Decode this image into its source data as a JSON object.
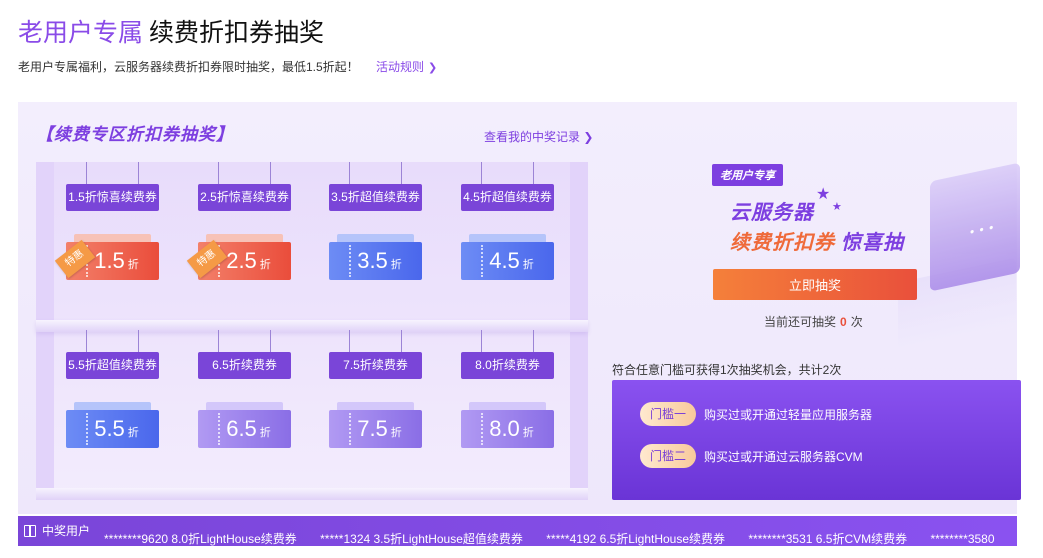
{
  "header": {
    "title_accent": "老用户专属",
    "title_main": "续费折扣券抽奖",
    "subtitle": "老用户专属福利，云服务器续费折扣券限时抽奖，最低1.5折起！",
    "rules_link": "活动规则"
  },
  "panel": {
    "section_title": "【续费专区折扣券抽奖】",
    "record_link": "查看我的中奖记录"
  },
  "coupons": [
    {
      "label": "1.5折惊喜续费券",
      "value": "1.5",
      "unit": "折",
      "color": "red",
      "badge": "特惠"
    },
    {
      "label": "2.5折惊喜续费券",
      "value": "2.5",
      "unit": "折",
      "color": "red",
      "badge": "特惠"
    },
    {
      "label": "3.5折超值续费券",
      "value": "3.5",
      "unit": "折",
      "color": "blue",
      "badge": ""
    },
    {
      "label": "4.5折超值续费券",
      "value": "4.5",
      "unit": "折",
      "color": "blue",
      "badge": ""
    },
    {
      "label": "5.5折超值续费券",
      "value": "5.5",
      "unit": "折",
      "color": "blue",
      "badge": ""
    },
    {
      "label": "6.5折续费券",
      "value": "6.5",
      "unit": "折",
      "color": "purple",
      "badge": ""
    },
    {
      "label": "7.5折续费券",
      "value": "7.5",
      "unit": "折",
      "color": "purple",
      "badge": ""
    },
    {
      "label": "8.0折续费券",
      "value": "8.0",
      "unit": "折",
      "color": "purple",
      "badge": ""
    }
  ],
  "promo": {
    "tag": "老用户专享",
    "line1": "云服务器",
    "line2_orange": "续费折扣券",
    "line2_purple": "惊喜抽",
    "draw_button": "立即抽奖",
    "remaining_prefix": "当前还可抽奖",
    "remaining_count": "0",
    "remaining_suffix": "次"
  },
  "thresholds": {
    "intro": "符合任意门槛可获得1次抽奖机会，共计2次",
    "items": [
      {
        "pill": "门槛一",
        "text": "购买过或开通过轻量应用服务器"
      },
      {
        "pill": "门槛二",
        "text": "购买过或开通过云服务器CVM"
      }
    ]
  },
  "ticker": {
    "head": "中奖用户",
    "items": [
      "********9620 8.0折LightHouse续费券",
      "*****1324 3.5折LightHouse超值续费券",
      "*****4192 6.5折LightHouse续费券",
      "********3531 6.5折CVM续费券",
      "********3580"
    ]
  },
  "colors": {
    "accent_purple": "#7d3fe0",
    "draw_orange": "#ef6a3a"
  }
}
